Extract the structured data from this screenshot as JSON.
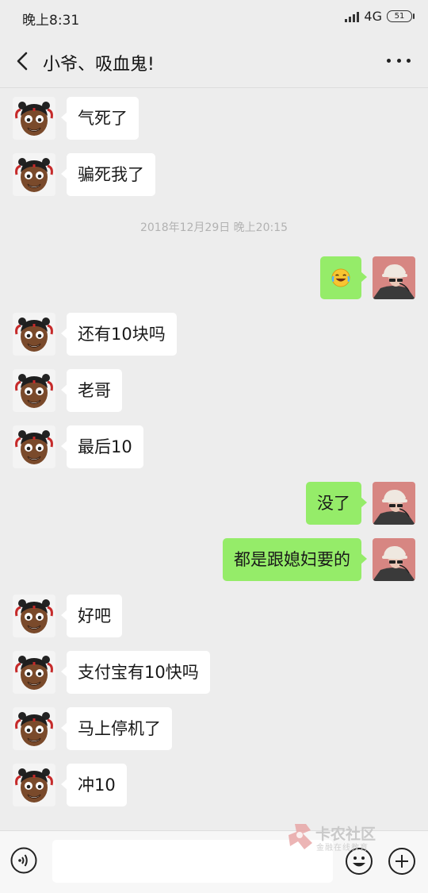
{
  "status_bar": {
    "time": "晚上8:31",
    "network": "4G",
    "battery": "51"
  },
  "header": {
    "title": "小爷、吸血鬼!"
  },
  "colors": {
    "background": "#ededed",
    "incoming_bubble": "#ffffff",
    "outgoing_bubble": "#95ec69"
  },
  "messages": [
    {
      "side": "left",
      "text": "气死了"
    },
    {
      "side": "left",
      "text": "骗死我了"
    },
    {
      "side": "timestamp",
      "text": "2018年12月29日 晚上20:15"
    },
    {
      "side": "right",
      "emoji": "laughing-crying-emoji"
    },
    {
      "side": "left",
      "text": "还有10块吗"
    },
    {
      "side": "left",
      "text": "老哥"
    },
    {
      "side": "left",
      "text": "最后10"
    },
    {
      "side": "right",
      "text": "没了"
    },
    {
      "side": "right",
      "text": "都是跟媳妇要的"
    },
    {
      "side": "left",
      "text": "好吧"
    },
    {
      "side": "left",
      "text": "支付宝有10快吗"
    },
    {
      "side": "left",
      "text": "马上停机了"
    },
    {
      "side": "left",
      "text": "冲10"
    }
  ],
  "watermark": {
    "title": "卡农社区",
    "subtitle": "金融在线教育"
  }
}
